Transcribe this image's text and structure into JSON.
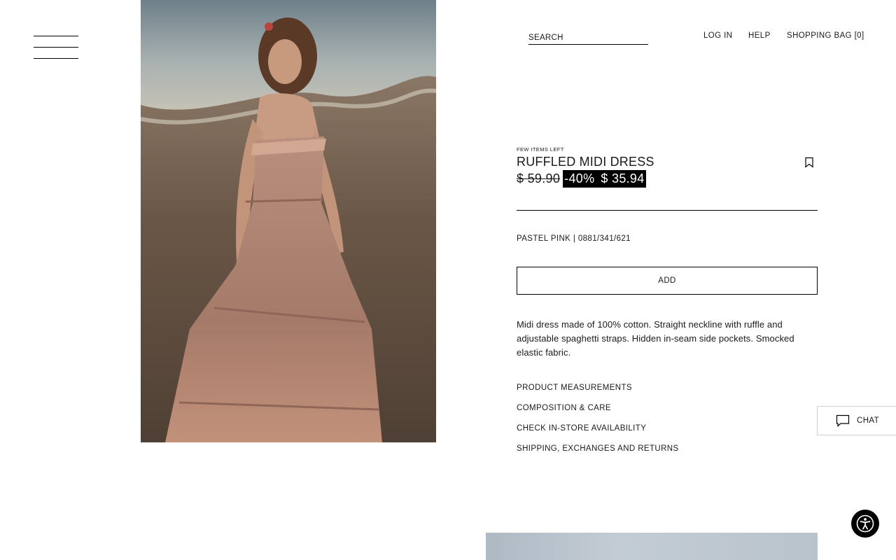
{
  "header": {
    "search_placeholder": "SEARCH",
    "login_label": "LOG IN",
    "help_label": "HELP",
    "bag_label": "SHOPPING BAG [0]"
  },
  "product": {
    "stock_note": "FEW ITEMS LEFT",
    "title": "RUFFLED MIDI DRESS",
    "old_price": "$ 59.90",
    "discount": "-40%",
    "sale_price": "$ 35.94",
    "color_ref": "PASTEL PINK | 0881/341/621",
    "add_label": "ADD",
    "description": "Midi dress made of 100% cotton. Straight neckline with ruffle and adjustable spaghetti straps. Hidden in-seam side pockets. Smocked elastic fabric.",
    "info_links": [
      "PRODUCT MEASUREMENTS",
      "COMPOSITION & CARE",
      "CHECK IN-STORE AVAILABILITY",
      "SHIPPING, EXCHANGES AND RETURNS"
    ]
  },
  "chat": {
    "label": "CHAT"
  },
  "icons": {
    "menu": "hamburger-menu-icon",
    "bookmark": "bookmark-icon",
    "chat": "chat-bubble-icon",
    "accessibility": "accessibility-icon"
  },
  "colors": {
    "text": "#1a1a1a",
    "sale_background": "#000000",
    "sale_text": "#ffffff"
  }
}
